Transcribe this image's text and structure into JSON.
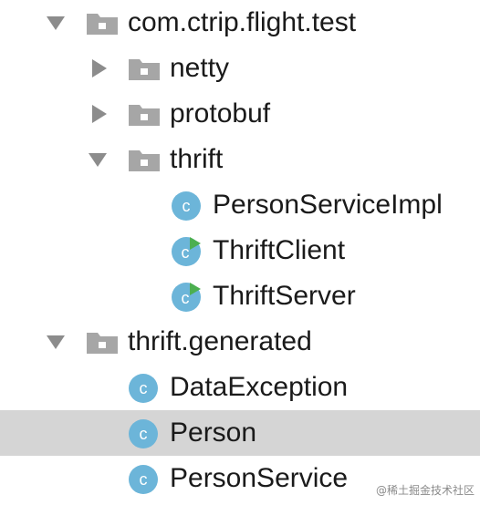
{
  "tree": {
    "items": [
      {
        "label": "com.ctrip.flight.test",
        "kind": "package",
        "expanded": true,
        "depth": 0
      },
      {
        "label": "netty",
        "kind": "package",
        "expanded": false,
        "depth": 1
      },
      {
        "label": "protobuf",
        "kind": "package",
        "expanded": false,
        "depth": 1
      },
      {
        "label": "thrift",
        "kind": "package",
        "expanded": true,
        "depth": 1
      },
      {
        "label": "PersonServiceImpl",
        "kind": "class",
        "depth": 2
      },
      {
        "label": "ThriftClient",
        "kind": "runnable-class",
        "depth": 2
      },
      {
        "label": "ThriftServer",
        "kind": "runnable-class",
        "depth": 2
      },
      {
        "label": "thrift.generated",
        "kind": "package",
        "expanded": true,
        "depth": 0
      },
      {
        "label": "DataException",
        "kind": "class",
        "depth": 1
      },
      {
        "label": "Person",
        "kind": "class",
        "depth": 1,
        "selected": true
      },
      {
        "label": "PersonService",
        "kind": "class",
        "depth": 1
      }
    ]
  },
  "watermark": "@稀土掘金技术社区",
  "colors": {
    "selection": "#d5d5d5",
    "arrow": "#8c8c8c",
    "folder": "#a6a6a6",
    "class_icon": "#6cb5d9",
    "run_badge": "#4caf50"
  }
}
